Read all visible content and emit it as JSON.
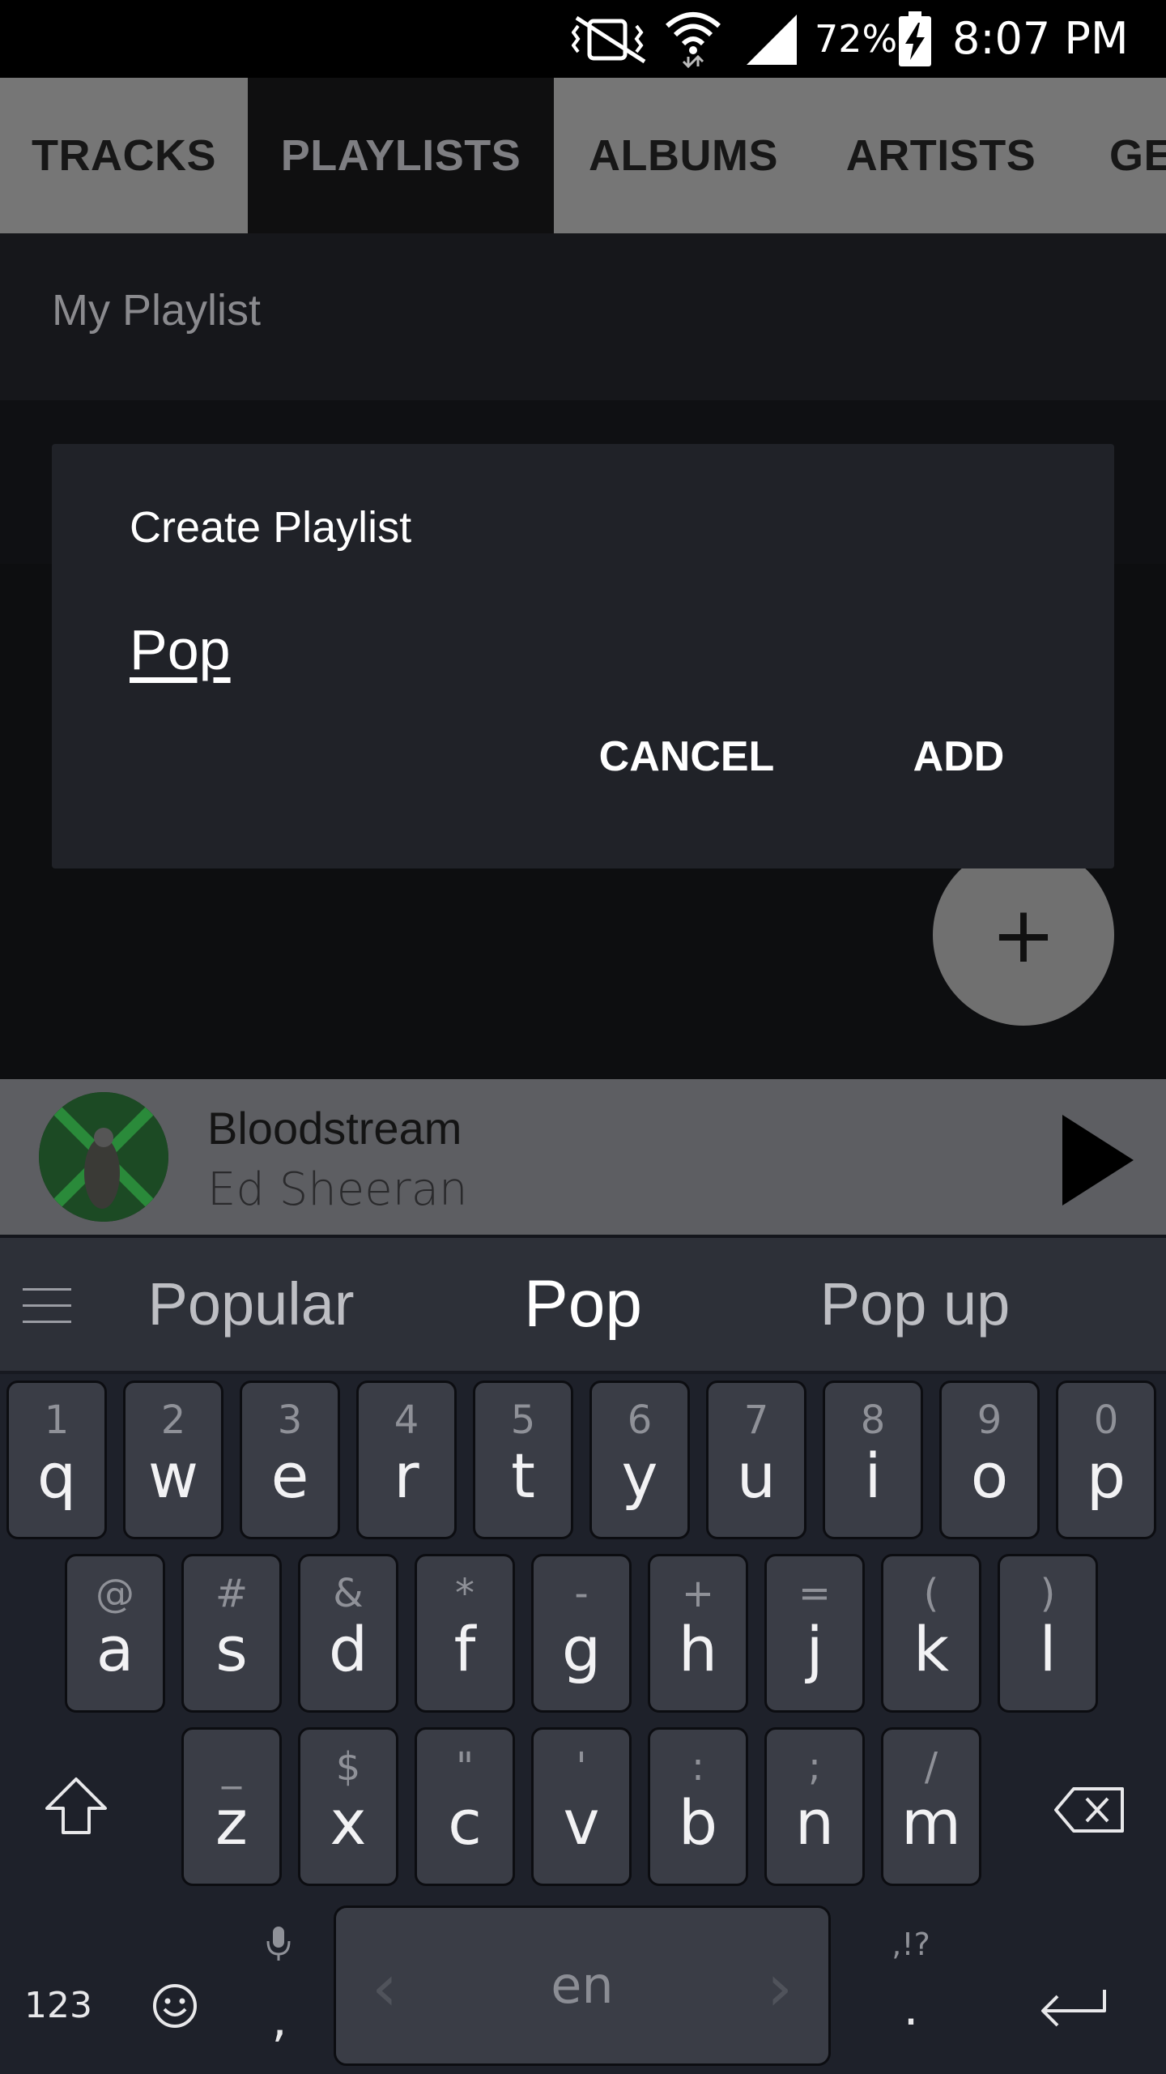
{
  "status_bar": {
    "battery": "72%",
    "time": "8:07 PM",
    "icons": [
      "vibrate-icon",
      "wifi-icon",
      "signal-icon",
      "battery-charging-icon"
    ]
  },
  "tabs": [
    {
      "label": "TRACKS",
      "active": false
    },
    {
      "label": "PLAYLISTS",
      "active": true
    },
    {
      "label": "ALBUMS",
      "active": false
    },
    {
      "label": "ARTISTS",
      "active": false
    },
    {
      "label": "GE",
      "active": false
    }
  ],
  "playlist": {
    "name": "My Playlist"
  },
  "dialog": {
    "title": "Create Playlist",
    "input_value": "Pop",
    "cancel_label": "CANCEL",
    "add_label": "ADD"
  },
  "fab": {
    "label": "+",
    "icon": "add-icon"
  },
  "player": {
    "title": "Bloodstream",
    "artist": "Ed Sheeran",
    "icon": "play-icon"
  },
  "keyboard": {
    "suggestions": [
      "Popular",
      "Pop",
      "Pop up"
    ],
    "row1": [
      {
        "hint": "1",
        "ch": "q"
      },
      {
        "hint": "2",
        "ch": "w"
      },
      {
        "hint": "3",
        "ch": "e"
      },
      {
        "hint": "4",
        "ch": "r"
      },
      {
        "hint": "5",
        "ch": "t"
      },
      {
        "hint": "6",
        "ch": "y"
      },
      {
        "hint": "7",
        "ch": "u"
      },
      {
        "hint": "8",
        "ch": "i"
      },
      {
        "hint": "9",
        "ch": "o"
      },
      {
        "hint": "0",
        "ch": "p"
      }
    ],
    "row2": [
      {
        "hint": "@",
        "ch": "a"
      },
      {
        "hint": "#",
        "ch": "s"
      },
      {
        "hint": "&",
        "ch": "d"
      },
      {
        "hint": "*",
        "ch": "f"
      },
      {
        "hint": "-",
        "ch": "g"
      },
      {
        "hint": "+",
        "ch": "h"
      },
      {
        "hint": "=",
        "ch": "j"
      },
      {
        "hint": "(",
        "ch": "k"
      },
      {
        "hint": ")",
        "ch": "l"
      }
    ],
    "row3": [
      {
        "hint": "_",
        "ch": "z"
      },
      {
        "hint": "$",
        "ch": "x"
      },
      {
        "hint": "\"",
        "ch": "c"
      },
      {
        "hint": "'",
        "ch": "v"
      },
      {
        "hint": ":",
        "ch": "b"
      },
      {
        "hint": ";",
        "ch": "n"
      },
      {
        "hint": "/",
        "ch": "m"
      }
    ],
    "num_label": "123",
    "comma": ",",
    "period": ".",
    "period_hint": ",!?",
    "space_lang": "en",
    "arrow_left": "‹",
    "arrow_right": "›"
  }
}
